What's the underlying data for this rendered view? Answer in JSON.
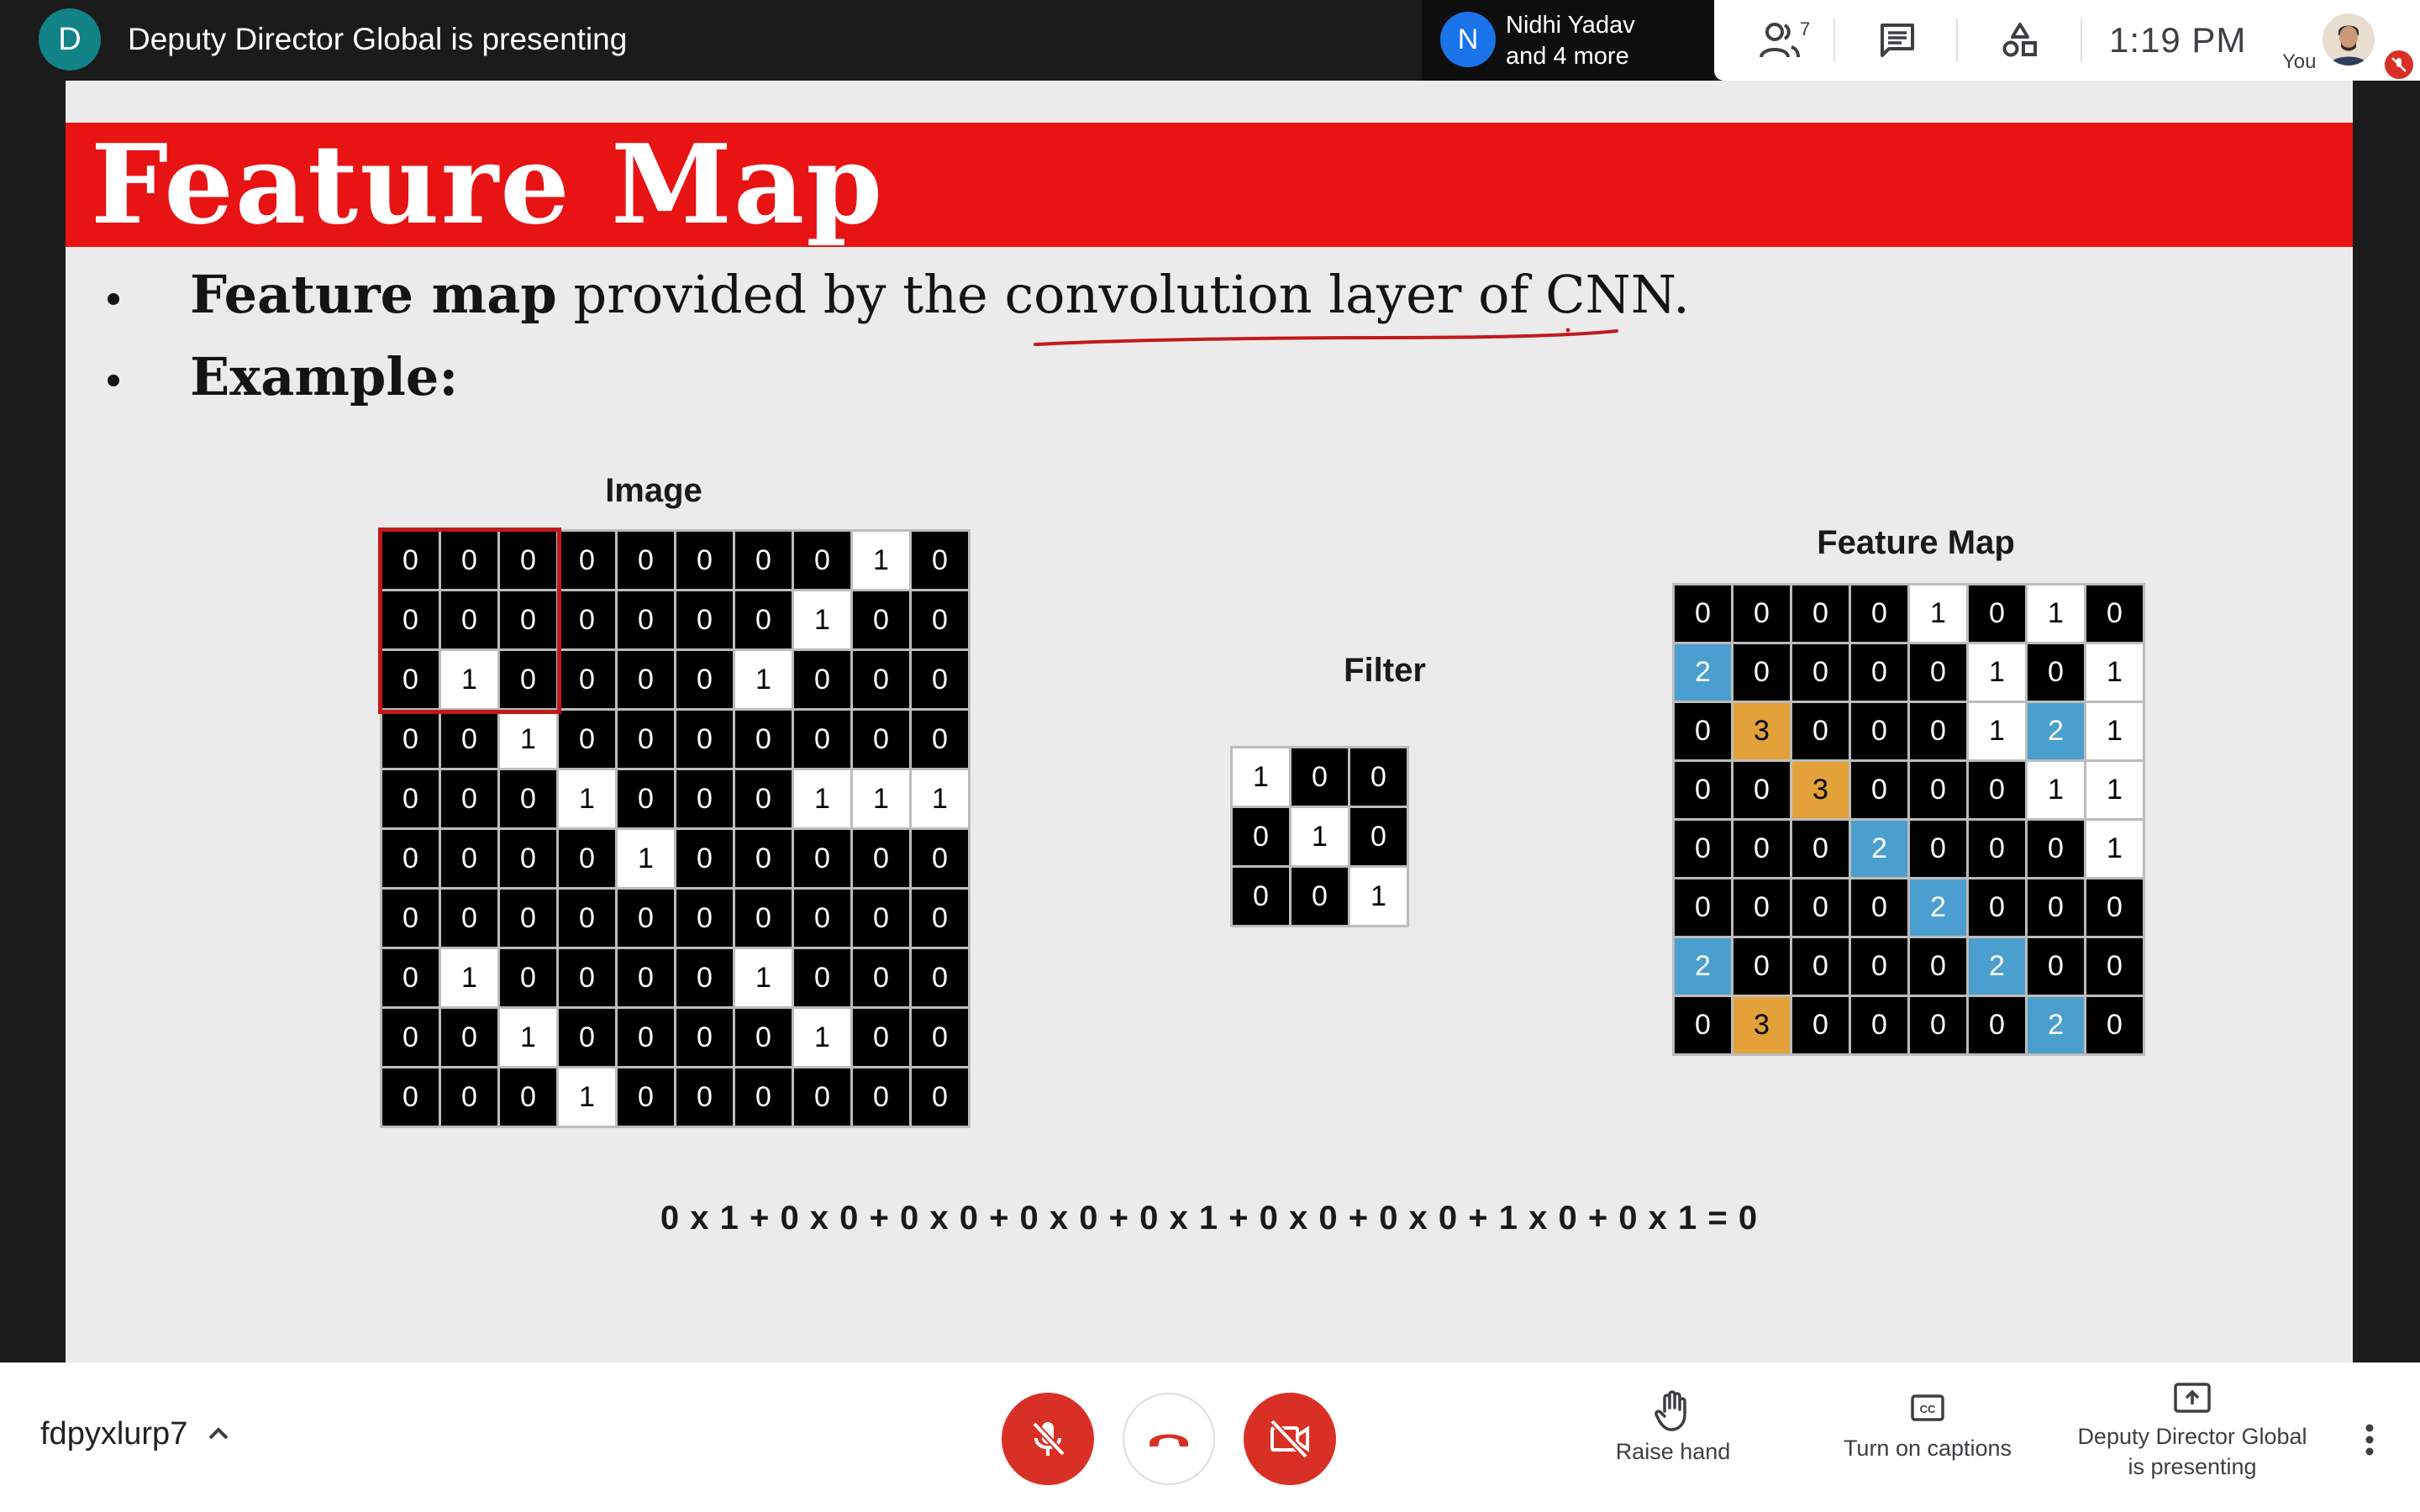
{
  "topbar": {
    "presenter_initial": "D",
    "presenter_text": "Deputy Director Global is presenting",
    "participant_initial": "N",
    "participant_name": "Nidhi Yadav",
    "participant_more": "and 4 more",
    "people_count": "7",
    "clock": "1:19 PM",
    "you_label": "You",
    "icons": [
      "people-icon",
      "chat-icon",
      "activities-icon",
      "mic-off-icon"
    ]
  },
  "slide": {
    "title": "Feature Map",
    "bullet1_bold": "Feature map",
    "bullet1_rest": " provided by the convolution layer of CNN.",
    "bullet2": "Example:",
    "image_label": "Image",
    "filter_label": "Filter",
    "feature_map_label": "Feature Map",
    "image_grid": [
      [
        "0",
        "0",
        "0",
        "0",
        "0",
        "0",
        "0",
        "0",
        "1",
        "0"
      ],
      [
        "0",
        "0",
        "0",
        "0",
        "0",
        "0",
        "0",
        "1",
        "0",
        "0"
      ],
      [
        "0",
        "1",
        "0",
        "0",
        "0",
        "0",
        "1",
        "0",
        "0",
        "0"
      ],
      [
        "0",
        "0",
        "1",
        "0",
        "0",
        "0",
        "0",
        "0",
        "0",
        "0"
      ],
      [
        "0",
        "0",
        "0",
        "1",
        "0",
        "0",
        "0",
        "1",
        "1",
        "1"
      ],
      [
        "0",
        "0",
        "0",
        "0",
        "1",
        "0",
        "0",
        "0",
        "0",
        "0"
      ],
      [
        "0",
        "0",
        "0",
        "0",
        "0",
        "0",
        "0",
        "0",
        "0",
        "0"
      ],
      [
        "0",
        "1",
        "0",
        "0",
        "0",
        "0",
        "1",
        "0",
        "0",
        "0"
      ],
      [
        "0",
        "0",
        "1",
        "0",
        "0",
        "0",
        "0",
        "1",
        "0",
        "0"
      ],
      [
        "0",
        "0",
        "0",
        "1",
        "0",
        "0",
        "0",
        "0",
        "0",
        "0"
      ]
    ],
    "filter_grid": [
      [
        "1",
        "0",
        "0"
      ],
      [
        "0",
        "1",
        "0"
      ],
      [
        "0",
        "0",
        "1"
      ]
    ],
    "feature_map_grid": [
      [
        "0",
        "0",
        "0",
        "0",
        "1",
        "0",
        "1",
        "0"
      ],
      [
        "2",
        "0",
        "0",
        "0",
        "0",
        "1",
        "0",
        "1"
      ],
      [
        "0",
        "3",
        "0",
        "0",
        "0",
        "1",
        "2",
        "1"
      ],
      [
        "0",
        "0",
        "3",
        "0",
        "0",
        "0",
        "1",
        "1"
      ],
      [
        "0",
        "0",
        "0",
        "2",
        "0",
        "0",
        "0",
        "1"
      ],
      [
        "0",
        "0",
        "0",
        "0",
        "2",
        "0",
        "0",
        "0"
      ],
      [
        "2",
        "0",
        "0",
        "0",
        "0",
        "2",
        "0",
        "0"
      ],
      [
        "0",
        "3",
        "0",
        "0",
        "0",
        "0",
        "2",
        "0"
      ]
    ],
    "colors": {
      "title_band": "#e81313",
      "value_2": "#4b9fcf",
      "value_3": "#e3a139",
      "highlight": "#c21a1a",
      "annotation": "#c21a1a"
    },
    "equation": "0 x 1 + 0 x 0 + 0 x 0 + 0 x 0 + 0 x 1 + 0 x 0 + 0 x 0 + 1 x 0 + 0 x 1 = 0"
  },
  "bottombar": {
    "meeting_code": "fdpyxlurp7",
    "raise_hand": "Raise hand",
    "captions": "Turn on captions",
    "presenting_line1": "Deputy Director Global",
    "presenting_line2": "is presenting",
    "icons": [
      "mic-off-icon",
      "end-call-icon",
      "camera-off-icon",
      "raise-hand-icon",
      "captions-icon",
      "present-icon",
      "more-options-icon"
    ]
  }
}
